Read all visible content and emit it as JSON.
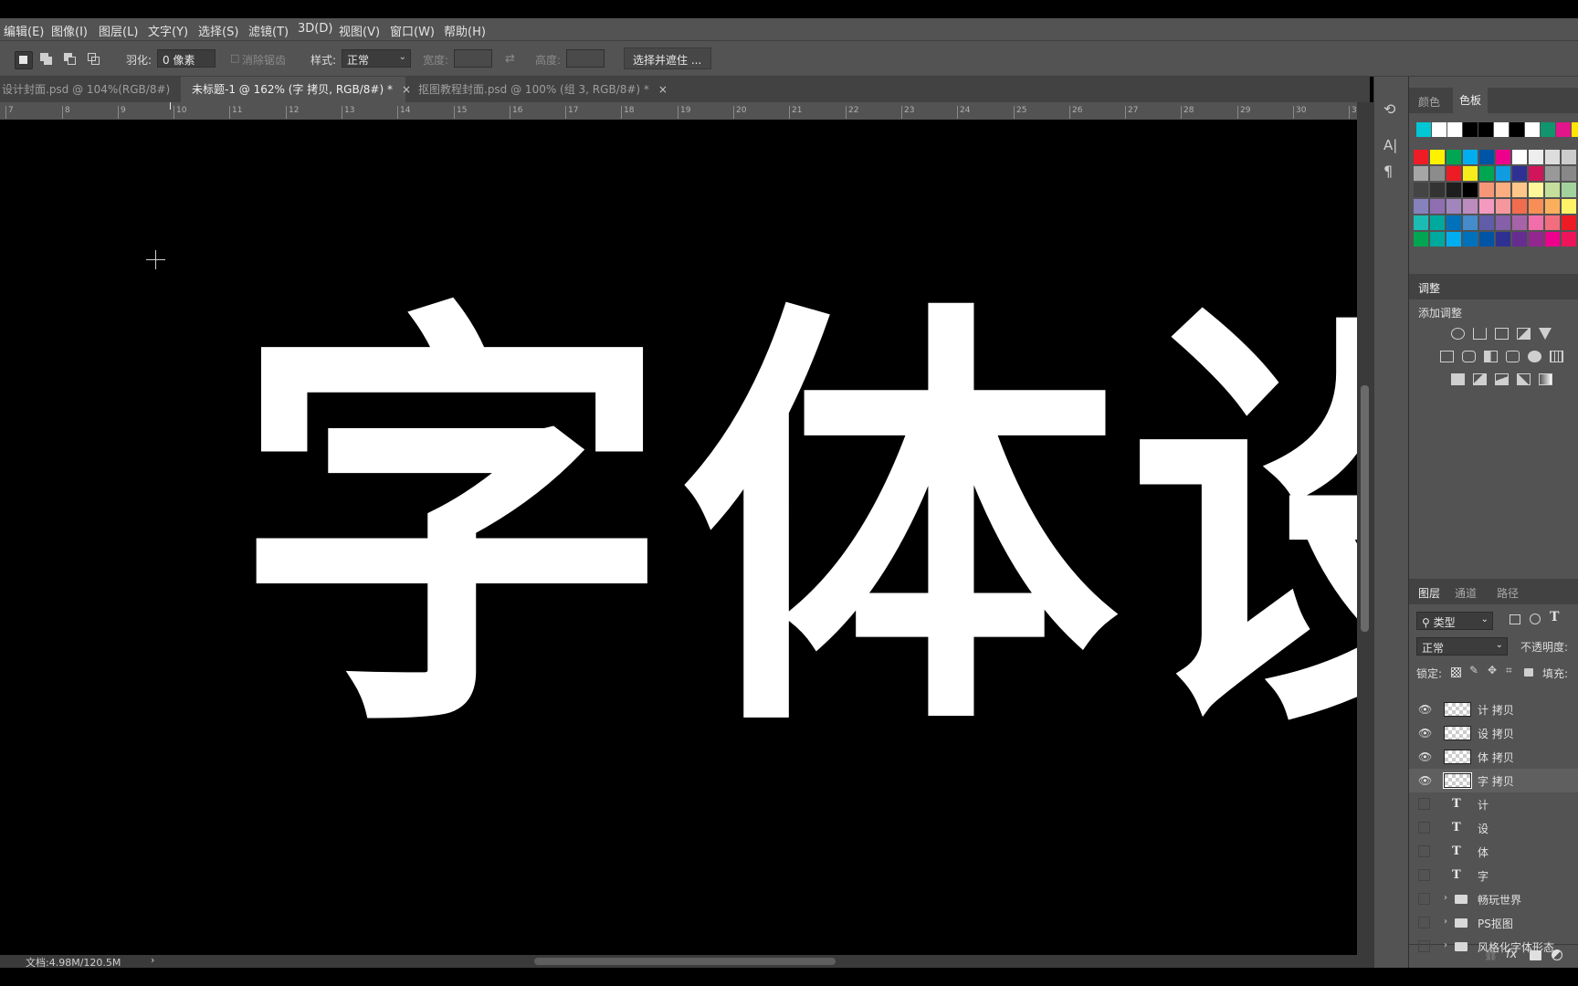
{
  "menu": [
    "编辑(E)",
    "图像(I)",
    "图层(L)",
    "文字(Y)",
    "选择(S)",
    "滤镜(T)",
    "3D(D)",
    "视图(V)",
    "窗口(W)",
    "帮助(H)"
  ],
  "options": {
    "feather_label": "羽化:",
    "feather_value": "0 像素",
    "antialias_label": "消除锯齿",
    "style_label": "样式:",
    "style_value": "正常",
    "width_label": "宽度:",
    "height_label": "高度:",
    "select_mask_button": "选择并遮住 ..."
  },
  "tabs": [
    {
      "label": "设计封面.psd @ 104%(RGB/8#)",
      "close": "×"
    },
    {
      "label": "未标题-1 @ 162% (字 拷贝, RGB/8#) *",
      "close": "×"
    },
    {
      "label": "抠图教程封面.psd @ 100% (组 3, RGB/8#) *",
      "close": "×"
    }
  ],
  "ruler_ticks": [
    "7",
    "8",
    "9",
    "10",
    "11",
    "12",
    "13",
    "14",
    "15",
    "16",
    "17",
    "18",
    "19",
    "20",
    "21",
    "22",
    "23",
    "24",
    "25",
    "26",
    "27",
    "28",
    "29",
    "30",
    "3"
  ],
  "canvas_text": "字体设",
  "status": {
    "doc_size": "文档:4.98M/120.5M",
    "arrow": "›"
  },
  "right_collapsed_icons": [
    "history-icon",
    "character-icon",
    "paragraph-icon"
  ],
  "swatches_panel": {
    "tabs": [
      "颜色",
      "色板"
    ],
    "active_tab": "色板",
    "top_row": [
      "#00c6d6",
      "#ffffff",
      "#ffffff",
      "#000000",
      "#000000",
      "#ffffff",
      "#000000",
      "#ffffff",
      "#11956e",
      "#e2158b",
      "#ffe600"
    ],
    "grid": [
      [
        "#ee1c25",
        "#fff200",
        "#00a651",
        "#00aeef",
        "#0054a6",
        "#ec008c",
        "#ffffff",
        "#eeeeee",
        "#dddddd",
        "#cccccc"
      ],
      [
        "#a6a6a6",
        "#8c8c8c",
        "#ed1c24",
        "#f7ed1c",
        "#00a650",
        "#0f9ce0",
        "#2e3192",
        "#d2145a",
        "#999999",
        "#888888"
      ],
      [
        "#444444",
        "#333333",
        "#1e1e1e",
        "#000000",
        "#f69679",
        "#f9ad81",
        "#fdc68a",
        "#fff799",
        "#c4df9b",
        "#a3d39c"
      ],
      [
        "#8781bd",
        "#8f6fb1",
        "#a186be",
        "#bd8cbf",
        "#f49ac1",
        "#f5989d",
        "#f26c4f",
        "#f68e55",
        "#fbaf5d",
        "#fff467"
      ],
      [
        "#1cbbb4",
        "#00a99d",
        "#0072bc",
        "#448ccb",
        "#605ca8",
        "#855fa8",
        "#a763a8",
        "#f06ea9",
        "#f26d7d",
        "#ed1c24"
      ],
      [
        "#00a651",
        "#00a99d",
        "#00aeef",
        "#0072bc",
        "#0054a6",
        "#2e3192",
        "#662d91",
        "#92278f",
        "#ec008c",
        "#ed145b"
      ]
    ]
  },
  "adjustments_panel": {
    "tab": "调整",
    "add_label": "添加调整",
    "icons_row1": [
      "brightness-icon",
      "levels-icon",
      "curves-icon",
      "exposure-icon",
      "vibrance-icon"
    ],
    "icons_row2": [
      "hue-saturation-icon",
      "color-balance-icon",
      "black-white-icon",
      "photo-filter-icon",
      "channel-mixer-icon",
      "color-lookup-icon"
    ],
    "icons_row3": [
      "invert-icon",
      "posterize-icon",
      "threshold-icon",
      "selective-color-icon",
      "gradient-map-icon"
    ]
  },
  "layers_panel": {
    "tabs": [
      "图层",
      "通道",
      "路径"
    ],
    "filter_label": "类型",
    "blend_mode": "正常",
    "opacity_label": "不透明度:",
    "lock_label": "锁定:",
    "fill_label": "填充:",
    "layers": [
      {
        "type": "pixel",
        "name": "计 拷贝",
        "visible": true,
        "selected": false
      },
      {
        "type": "pixel",
        "name": "设 拷贝",
        "visible": true,
        "selected": false
      },
      {
        "type": "pixel",
        "name": "体 拷贝",
        "visible": true,
        "selected": false
      },
      {
        "type": "pixel",
        "name": "字 拷贝",
        "visible": true,
        "selected": true
      },
      {
        "type": "text",
        "name": "计",
        "visible": false,
        "selected": false
      },
      {
        "type": "text",
        "name": "设",
        "visible": false,
        "selected": false
      },
      {
        "type": "text",
        "name": "体",
        "visible": false,
        "selected": false
      },
      {
        "type": "text",
        "name": "字",
        "visible": false,
        "selected": false
      },
      {
        "type": "group",
        "name": "畅玩世界",
        "visible": false,
        "selected": false
      },
      {
        "type": "group",
        "name": "PS抠图",
        "visible": false,
        "selected": false
      },
      {
        "type": "group",
        "name": "风格化字体形态",
        "visible": false,
        "selected": false
      }
    ],
    "footer": {
      "fx": "fx"
    }
  }
}
